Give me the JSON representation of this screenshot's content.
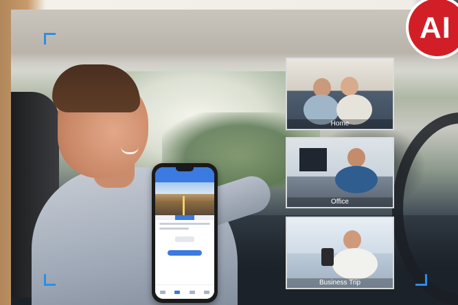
{
  "badge": {
    "text": "AI"
  },
  "scenes": [
    {
      "label": "Home"
    },
    {
      "label": "Office"
    },
    {
      "label": "Business Trip"
    }
  ],
  "colors": {
    "badge_red": "#d21f27",
    "bracket_blue": "#2e8de6",
    "app_blue": "#3b7ae0"
  }
}
